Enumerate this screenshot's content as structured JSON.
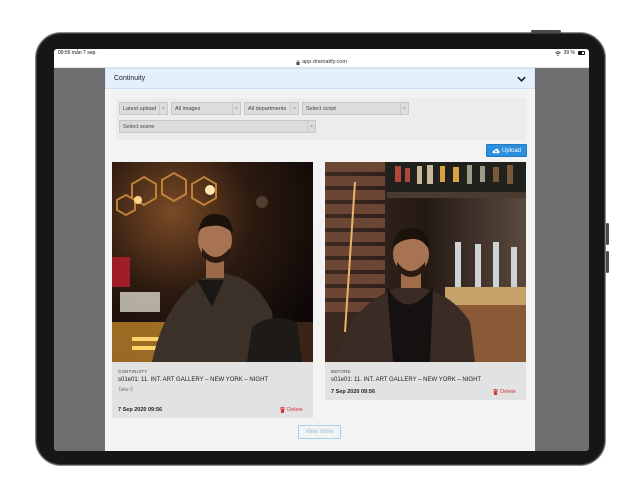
{
  "device": {
    "status_time": "09:56",
    "status_date": "mån 7 sep.",
    "wifi_icon": "wifi-icon",
    "battery_pct": "39 %"
  },
  "browser": {
    "url": "app.dramatify.com"
  },
  "panel": {
    "title": "Continuity",
    "toggle_icon": "chevron-down-icon"
  },
  "filters": {
    "sort": "Latest upload",
    "images": "All images",
    "departments": "All departments",
    "script": "Select script",
    "scene": "Select scene",
    "clear_glyph": "×"
  },
  "upload": {
    "label": "Upload",
    "icon": "cloud-upload-icon"
  },
  "cards": [
    {
      "kind": "CONTINUITY",
      "scene": "s01e01: 11. INT. ART GALLERY – NEW YORK – NIGHT",
      "take": "Take 5",
      "date": "7 Sep 2020 09:56",
      "delete_label": "Delete"
    },
    {
      "kind": "BEFORE",
      "scene": "s01e01: 11. INT. ART GALLERY – NEW YORK – NIGHT",
      "take": "",
      "date": "7 Sep 2020 09:56",
      "delete_label": "Delete"
    }
  ],
  "view_more": "View more",
  "colors": {
    "accent": "#2d8fdc",
    "delete": "#d23b3b",
    "header_bg": "#e4f0fc"
  }
}
